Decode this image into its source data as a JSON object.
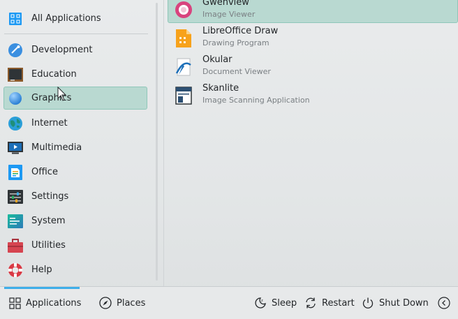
{
  "categories": [
    {
      "label": "All Applications",
      "icon": "all-applications-icon"
    },
    {
      "label": "Development",
      "icon": "development-icon"
    },
    {
      "label": "Education",
      "icon": "education-icon"
    },
    {
      "label": "Graphics",
      "icon": "graphics-icon"
    },
    {
      "label": "Internet",
      "icon": "internet-icon"
    },
    {
      "label": "Multimedia",
      "icon": "multimedia-icon"
    },
    {
      "label": "Office",
      "icon": "office-icon"
    },
    {
      "label": "Settings",
      "icon": "settings-icon"
    },
    {
      "label": "System",
      "icon": "system-icon"
    },
    {
      "label": "Utilities",
      "icon": "utilities-icon"
    },
    {
      "label": "Help",
      "icon": "help-icon"
    }
  ],
  "selected_category": "Graphics",
  "apps": [
    {
      "name": "Gwenview",
      "description": "Image Viewer",
      "icon": "gwenview-icon"
    },
    {
      "name": "LibreOffice Draw",
      "description": "Drawing Program",
      "icon": "libreoffice-draw-icon"
    },
    {
      "name": "Okular",
      "description": "Document Viewer",
      "icon": "okular-icon"
    },
    {
      "name": "Skanlite",
      "description": "Image Scanning Application",
      "icon": "skanlite-icon"
    }
  ],
  "selected_app": "Gwenview",
  "bottom": {
    "applications_label": "Applications",
    "places_label": "Places",
    "sleep_label": "Sleep",
    "restart_label": "Restart",
    "shutdown_label": "Shut Down"
  },
  "colors": {
    "selection": "#b9d9d1",
    "selection_border": "#8fc7b9",
    "accent": "#3daee9"
  }
}
